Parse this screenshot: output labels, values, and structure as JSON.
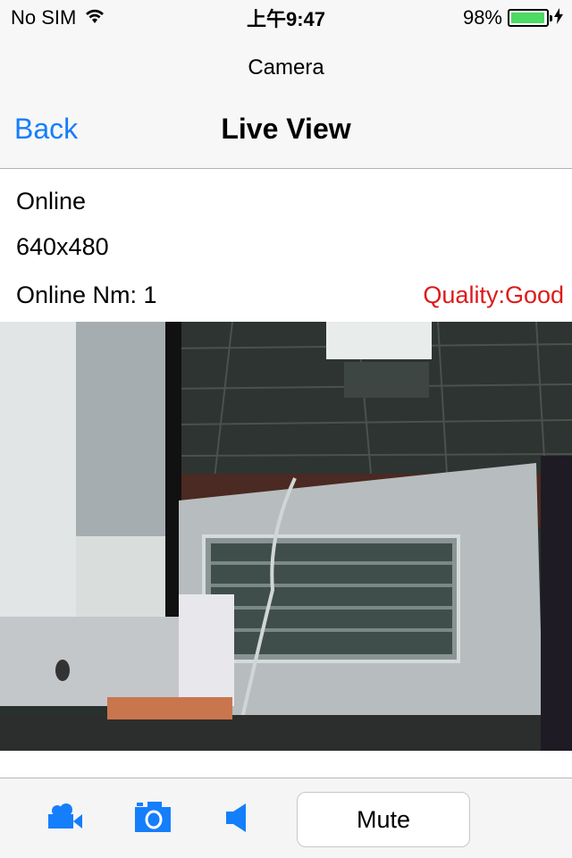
{
  "status_bar": {
    "carrier": "No SIM",
    "time": "上午9:47",
    "battery_percent_label": "98%",
    "battery_level": 0.98,
    "icons": [
      "wifi-icon",
      "battery-icon",
      "charging-bolt-icon"
    ]
  },
  "nav": {
    "subtitle": "Camera",
    "back_label": "Back",
    "title": "Live View"
  },
  "info": {
    "status": "Online",
    "resolution": "640x480",
    "online_count": "Online Nm: 1",
    "quality": "Quality:Good"
  },
  "colors": {
    "accent": "#157efb",
    "quality": "#dd1a1a",
    "battery": "#4cd964"
  },
  "video": {
    "description": "Live camera feed of an office desk with an iMac and a window box"
  },
  "toolbar": {
    "icons": [
      "video-camera-icon",
      "camera-icon",
      "speaker-icon"
    ],
    "mute_label": "Mute"
  }
}
